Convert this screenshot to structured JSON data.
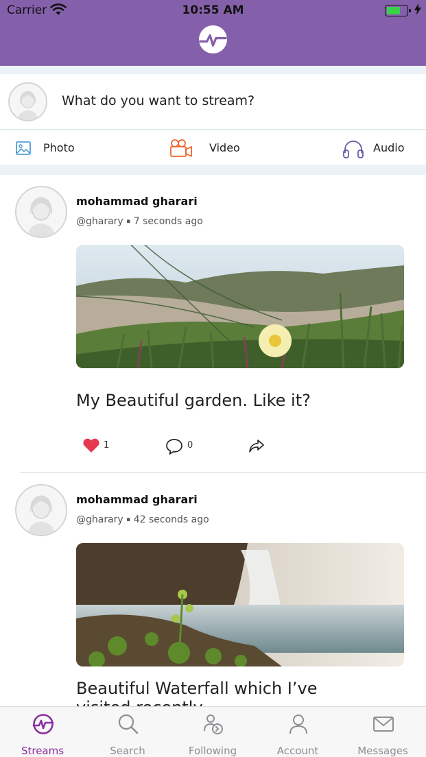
{
  "status_bar": {
    "carrier": "Carrier",
    "time": "10:55 AM",
    "battery_level": 0.7
  },
  "composer": {
    "prompt": "What do you want to stream?"
  },
  "media_buttons": [
    {
      "label": "Photo",
      "icon": "photo-icon"
    },
    {
      "label": "Video",
      "icon": "video-camera-icon"
    },
    {
      "label": "Audio",
      "icon": "headphones-icon"
    }
  ],
  "posts": [
    {
      "author": "mohammad gharari",
      "handle": "@gharary",
      "separator": "▪",
      "time_ago": "7 seconds ago",
      "image": "garden flower photo",
      "caption": "My Beautiful garden. Like it?",
      "likes": "1",
      "comments": "0"
    },
    {
      "author": "mohammad gharari",
      "handle": "@gharary",
      "separator": "▪",
      "time_ago": "42 seconds ago",
      "image": "waterfall photo",
      "caption": "Beautiful Waterfall which I’ve visited recently"
    }
  ],
  "tabs": [
    {
      "label": "Streams",
      "icon": "streams-icon",
      "active": true
    },
    {
      "label": "Search",
      "icon": "search-icon",
      "active": false
    },
    {
      "label": "Following",
      "icon": "following-icon",
      "active": false
    },
    {
      "label": "Account",
      "icon": "account-icon",
      "active": false
    },
    {
      "label": "Messages",
      "icon": "messages-icon",
      "active": false
    }
  ],
  "colors": {
    "brand": "#8560aa",
    "accent": "#8a2f9f",
    "like": "#e53950",
    "video": "#f0642d",
    "photo": "#3a8fcf",
    "audio": "#6a5aa8"
  }
}
